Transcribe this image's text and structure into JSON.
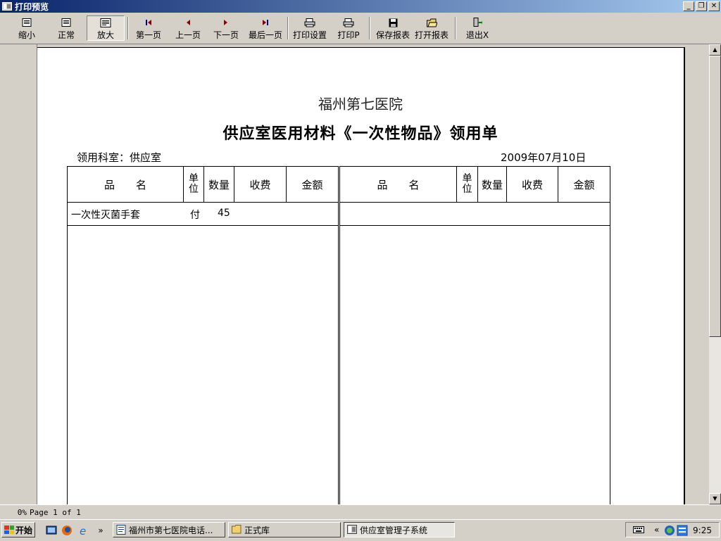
{
  "window": {
    "title": "打印预览"
  },
  "toolbar": {
    "buttons": [
      {
        "label": "缩小",
        "icon": "zoom-out-icon"
      },
      {
        "label": "正常",
        "icon": "normal-size-icon"
      },
      {
        "label": "放大",
        "icon": "zoom-in-icon"
      },
      {
        "label": "第一页",
        "icon": "first-page-icon"
      },
      {
        "label": "上一页",
        "icon": "previous-page-icon"
      },
      {
        "label": "下一页",
        "icon": "next-page-icon"
      },
      {
        "label": "最后一页",
        "icon": "last-page-icon"
      },
      {
        "label": "打印设置",
        "icon": "print-setup-icon"
      },
      {
        "label": "打印P",
        "icon": "printer-icon"
      },
      {
        "label": "保存报表",
        "icon": "save-disk-icon"
      },
      {
        "label": "打开报表",
        "icon": "open-folder-icon"
      },
      {
        "label": "退出X",
        "icon": "exit-door-icon"
      }
    ]
  },
  "report": {
    "hospital": "福州第七医院",
    "title": "供应室医用材料《一次性物品》领用单",
    "dept_label": "领用科室：供应室",
    "date": "2009年07月10日",
    "headers": {
      "name": "品　　名",
      "unit_top": "单",
      "unit_bottom": "位",
      "qty": "数量",
      "fee": "收费",
      "amount": "金额"
    },
    "rows": [
      {
        "name": "一次性灭菌手套",
        "unit": "付",
        "qty": "45"
      }
    ]
  },
  "status": {
    "percent": "0%",
    "page": "Page 1 of 1"
  },
  "taskbar": {
    "start": "开始",
    "tasks": [
      {
        "label": "福州市第七医院电话...",
        "icon": "word-document-icon"
      },
      {
        "label": "正式库",
        "icon": "folder-icon"
      },
      {
        "label": "供应室管理子系统",
        "icon": "app-window-icon",
        "active": true
      }
    ],
    "clock": "9:25",
    "more": "»",
    "tray_more": "«"
  }
}
